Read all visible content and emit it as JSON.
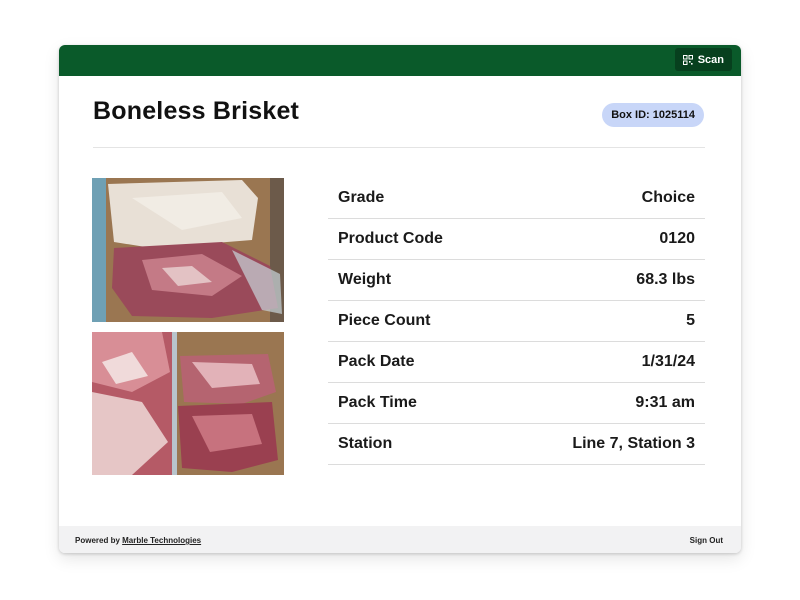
{
  "topbar": {
    "scan_label": "Scan",
    "bar_color": "#0a5a2a"
  },
  "product": {
    "title": "Boneless Brisket",
    "box_id": "Box ID: 1025114"
  },
  "details": [
    {
      "label": "Grade",
      "value": "Choice"
    },
    {
      "label": "Product Code",
      "value": "0120"
    },
    {
      "label": "Weight",
      "value": "68.3 lbs"
    },
    {
      "label": "Piece Count",
      "value": "5"
    },
    {
      "label": "Pack Date",
      "value": "1/31/24"
    },
    {
      "label": "Pack Time",
      "value": "9:31 am"
    },
    {
      "label": "Station",
      "value": "Line 7, Station 3"
    }
  ],
  "footer": {
    "powered_prefix": "Powered by ",
    "powered_brand": "Marble Technologies",
    "sign_out": "Sign Out"
  },
  "icons": {
    "scan": "qr-code-icon"
  }
}
